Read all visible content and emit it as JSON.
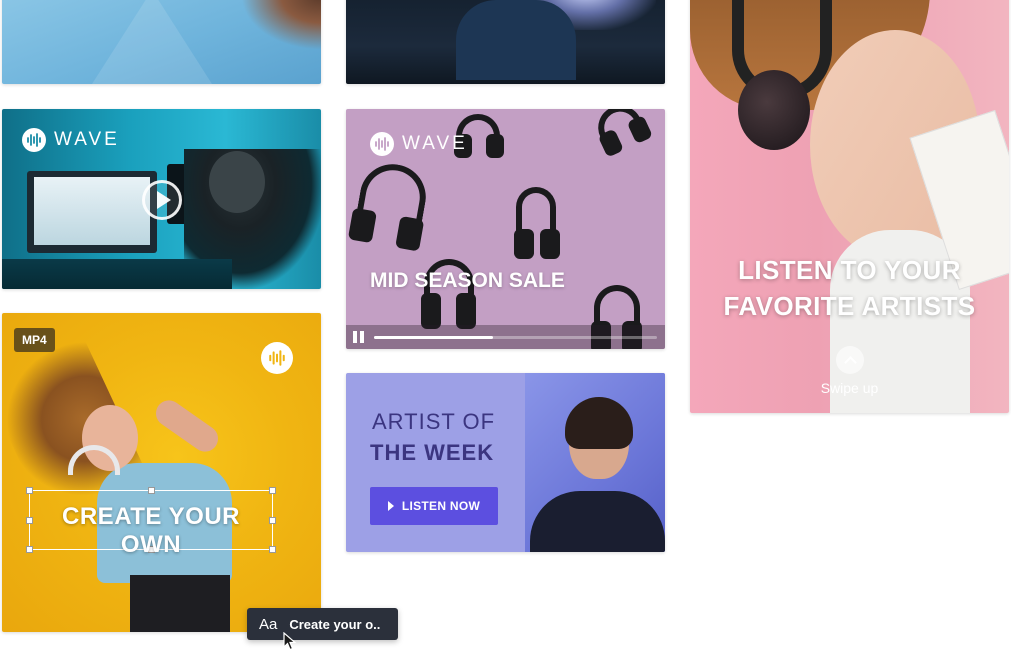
{
  "brand": {
    "logo_text": "WAVE",
    "accent": "#5c4fe0",
    "dark_text": "#3b3580"
  },
  "cards": {
    "studio": {
      "logo_text": "WAVE",
      "play_icon": "play-icon"
    },
    "create": {
      "badge": "MP4",
      "text": "CREATE YOUR OWN"
    },
    "sale": {
      "logo_text": "WAVE",
      "title": "MID SEASON SALE",
      "progress": 0.42
    },
    "artist": {
      "line1": "ARTIST OF",
      "line2": "THE WEEK",
      "button_label": "LISTEN NOW"
    },
    "story": {
      "title_line1": "LISTEN TO YOUR",
      "title_line2": "FAVORITE ARTISTS",
      "swipe_label": "Swipe up"
    }
  },
  "tooltip": {
    "icon_text": "Aa",
    "label": "Create your o.."
  }
}
